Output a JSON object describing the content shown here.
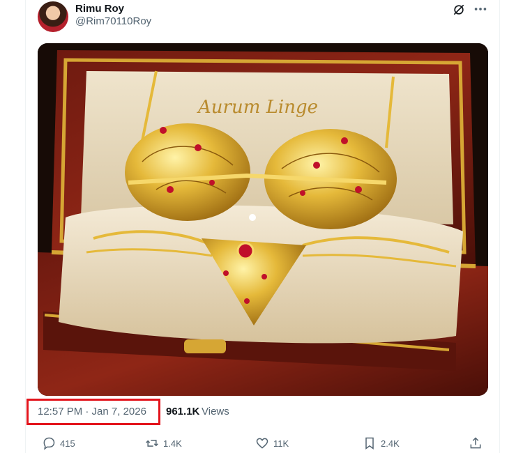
{
  "tweet": {
    "author_name": "Rimu Roy",
    "author_handle": "@Rim70110Roy",
    "image_caption_text": "Aurum Linge",
    "timestamp": "12:57 PM · Jan 7, 2026",
    "views_count": "961.1K",
    "views_label": "Views"
  },
  "actions": {
    "replies": "415",
    "reposts": "1.4K",
    "likes": "11K",
    "bookmarks": "2.4K"
  },
  "icons": {
    "grok": "grok-icon",
    "more": "more-icon",
    "reply": "reply-icon",
    "repost": "repost-icon",
    "like": "heart-icon",
    "bookmark": "bookmark-icon",
    "share": "share-icon"
  },
  "colors": {
    "highlight_box": "#e3141c",
    "secondary_text": "#536471",
    "primary_text": "#0f1419"
  }
}
